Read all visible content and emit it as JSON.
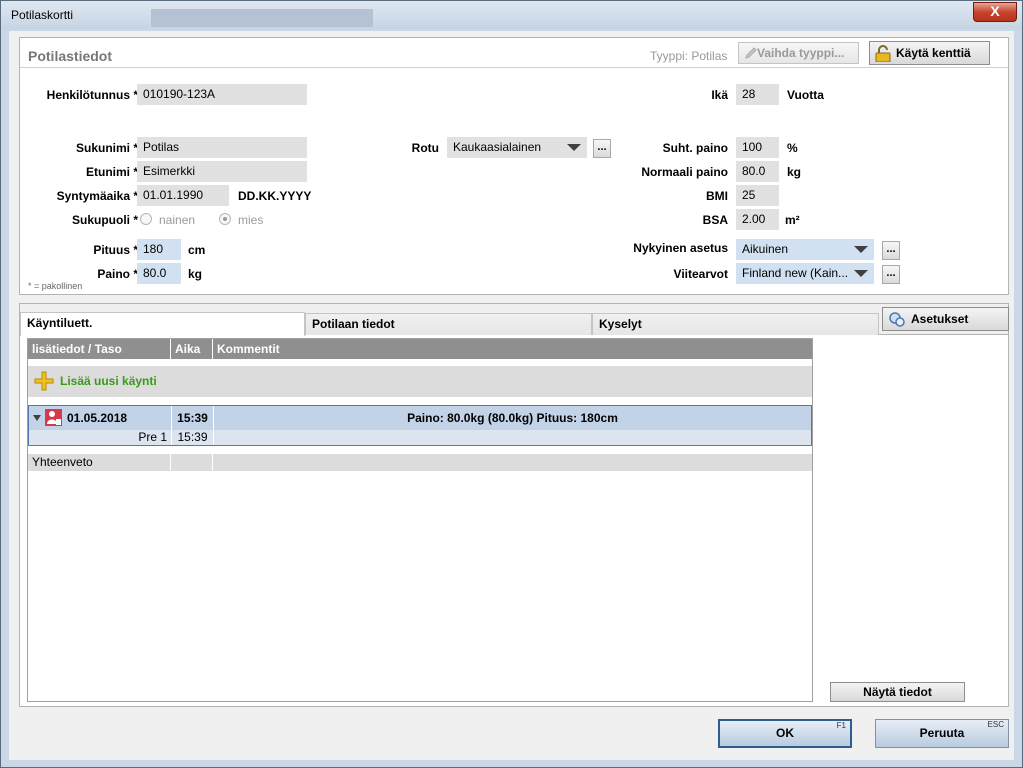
{
  "window": {
    "title": "Potilaskortti",
    "close_glyph": "X"
  },
  "info": {
    "title": "Potilastiedot",
    "type_label": "Tyyppi: Potilas",
    "change_type_button": "Vaihda tyyppi...",
    "use_fields_button": "Käytä kenttiä",
    "ssn_label": "Henkilötunnus *",
    "ssn_value": "010190-123A",
    "age_label": "Ikä",
    "age_value": "28",
    "age_unit": "Vuotta",
    "surname_label": "Sukunimi *",
    "surname_value": "Potilas",
    "firstname_label": "Etunimi *",
    "firstname_value": "Esimerkki",
    "birthdate_label": "Syntymäaika *",
    "birthdate_value": "01.01.1990",
    "birthdate_format": "DD.KK.YYYY",
    "sex_label": "Sukupuoli *",
    "sex_option_female": "nainen",
    "sex_option_male": "mies",
    "height_label": "Pituus *",
    "height_value": "180",
    "height_unit": "cm",
    "weight_label": "Paino *",
    "weight_value": "80.0",
    "weight_unit": "kg",
    "race_label": "Rotu",
    "race_value": "Kaukaasialainen",
    "ellipsis": "...",
    "rel_weight_label": "Suht. paino",
    "rel_weight_value": "100",
    "rel_weight_unit": "%",
    "normal_weight_label": "Normaali paino",
    "normal_weight_value": "80.0",
    "normal_weight_unit": "kg",
    "bmi_label": "BMI",
    "bmi_value": "25",
    "bsa_label": "BSA",
    "bsa_value": "2.00",
    "bsa_unit": "m²",
    "current_setting_label": "Nykyinen asetus",
    "current_setting_value": "Aikuinen",
    "reference_label": "Viitearvot",
    "reference_value": "Finland new (Kain...",
    "footnote": "* = pakollinen"
  },
  "tabs": {
    "items": [
      "Käyntiluett.",
      "Potilaan tiedot",
      "Kyselyt"
    ],
    "settings_button": "Asetukset"
  },
  "grid": {
    "columns": [
      "lisätiedot / Taso",
      "Aika",
      "Kommentit"
    ],
    "add_visit": "Lisää uusi käynti",
    "visit": {
      "date": "01.05.2018",
      "time": "15:39",
      "comment": "Paino: 80.0kg (80.0kg)   Pituus: 180cm",
      "sub_level": "Pre 1",
      "sub_time": "15:39"
    },
    "summary": "Yhteenveto"
  },
  "show_details_button": "Näytä tiedot",
  "footer": {
    "ok_label": "OK",
    "ok_hint": "F1",
    "cancel_label": "Peruuta",
    "cancel_hint": "ESC"
  }
}
